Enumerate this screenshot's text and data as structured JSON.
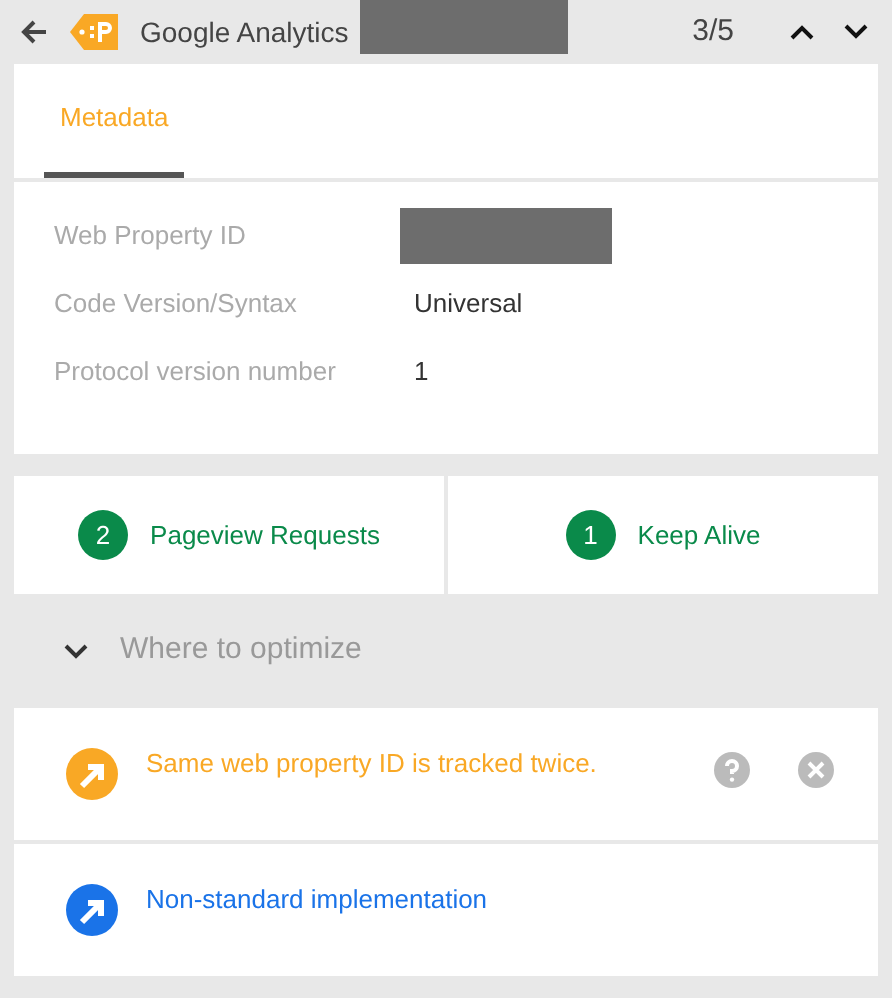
{
  "header": {
    "title": "Google Analytics",
    "title_redacted": true,
    "position": "3/5"
  },
  "tabs": [
    {
      "label": "Metadata",
      "selected": true
    }
  ],
  "metadata": [
    {
      "label": "Web Property ID"
    },
    {
      "label": "Code Version/Syntax",
      "value": "Universal"
    },
    {
      "label": "Protocol version number",
      "value": "1"
    }
  ],
  "counts": [
    {
      "count": "2",
      "label": "Pageview Requests"
    },
    {
      "count": "1",
      "label": "Keep Alive"
    }
  ],
  "section": {
    "title": "Where to optimize",
    "expanded": true
  },
  "issues": [
    {
      "text": "Same web property ID is tracked twice.",
      "color": "#f9a825",
      "actions": true
    },
    {
      "text": "Non-standard implementation",
      "color": "#1a73e8",
      "actions": false
    }
  ]
}
